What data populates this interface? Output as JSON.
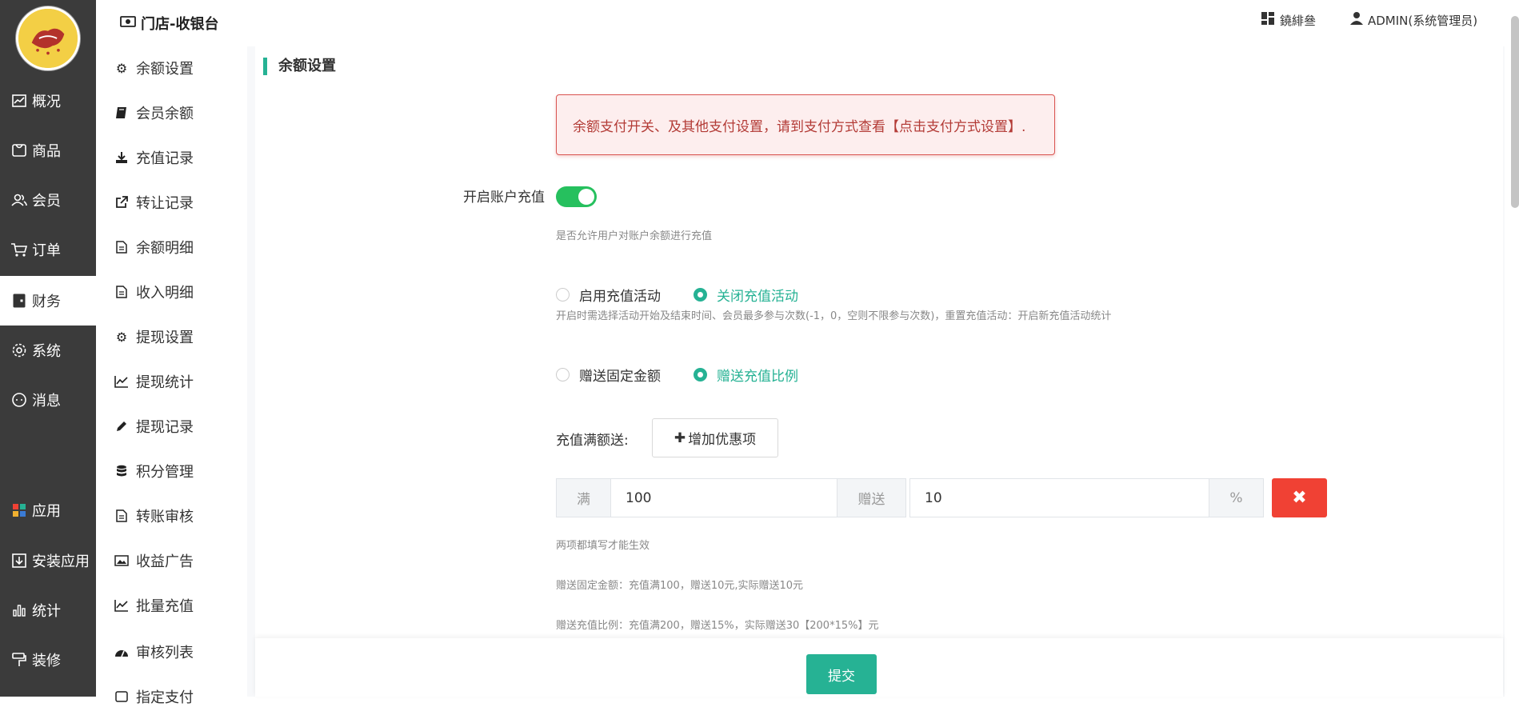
{
  "header": {
    "breadcrumb": "门店-收银台",
    "switch_label": "鐃緋叄",
    "user_label": "ADMIN(系统管理员)"
  },
  "rail": {
    "items": [
      {
        "label": "概况",
        "icon": "chart-icon"
      },
      {
        "label": "商品",
        "icon": "box-icon"
      },
      {
        "label": "会员",
        "icon": "users-icon"
      },
      {
        "label": "订单",
        "icon": "cart-icon"
      },
      {
        "label": "财务",
        "icon": "wallet-icon",
        "active": true
      },
      {
        "label": "系统",
        "icon": "gear-icon"
      },
      {
        "label": "消息",
        "icon": "chat-icon"
      },
      {
        "label": "应用",
        "icon": "apps-icon"
      },
      {
        "label": "安装应用",
        "icon": "download-icon"
      },
      {
        "label": "统计",
        "icon": "bar-chart-icon"
      },
      {
        "label": "装修",
        "icon": "paint-roller-icon"
      }
    ]
  },
  "subnav": {
    "items": [
      {
        "label": "余额设置",
        "icon": "gear-icon"
      },
      {
        "label": "会员余额",
        "icon": "book-icon"
      },
      {
        "label": "充值记录",
        "icon": "download-icon"
      },
      {
        "label": "转让记录",
        "icon": "external-link-icon"
      },
      {
        "label": "余额明细",
        "icon": "file-icon"
      },
      {
        "label": "收入明细",
        "icon": "file-icon"
      },
      {
        "label": "提现设置",
        "icon": "gear-icon"
      },
      {
        "label": "提现统计",
        "icon": "line-chart-icon"
      },
      {
        "label": "提现记录",
        "icon": "pencil-icon"
      },
      {
        "label": "积分管理",
        "icon": "database-icon"
      },
      {
        "label": "转账审核",
        "icon": "file-icon"
      },
      {
        "label": "收益广告",
        "icon": "image-icon"
      },
      {
        "label": "批量充值",
        "icon": "line-chart-icon"
      },
      {
        "label": "审核列表",
        "icon": "dashboard-icon"
      },
      {
        "label": "指定支付",
        "icon": "card-icon"
      }
    ]
  },
  "main": {
    "title": "余额设置",
    "alert": "余额支付开关、及其他支付设置，请到支付方式查看【点击支付方式设置】.",
    "recharge_label": "开启账户充值",
    "recharge_enabled": true,
    "recharge_hint": "是否允许用户对账户余额进行充值",
    "activity_options": [
      "启用充值活动",
      "关闭充值活动"
    ],
    "activity_selected": "关闭充值活动",
    "activity_hint": "开启时需选择活动开始及结束时间、会员最多参与次数(-1，0，空则不限参与次数)，重置充值活动：开启新充值活动统计",
    "gift_options": [
      "赠送固定金额",
      "赠送充值比例"
    ],
    "gift_selected": "赠送充值比例",
    "full_gift_label": "充值满额送:",
    "add_button": "增加优惠项",
    "rule": {
      "prefix": "满",
      "amount": "100",
      "middle": "赠送",
      "gift": "10",
      "suffix": "%"
    },
    "hint_both": "两项都填写才能生效",
    "hint_fixed": "赠送固定金额：充值满100，赠送10元,实际赠送10元",
    "hint_ratio": "赠送充值比例：充值满200，赠送15%，实际赠送30【200*15%】元",
    "submit": "提交"
  },
  "colors": {
    "accent": "#26b294",
    "danger": "#f04134",
    "rail_bg": "#3b3b3b",
    "toggle_on": "#26c05e"
  }
}
